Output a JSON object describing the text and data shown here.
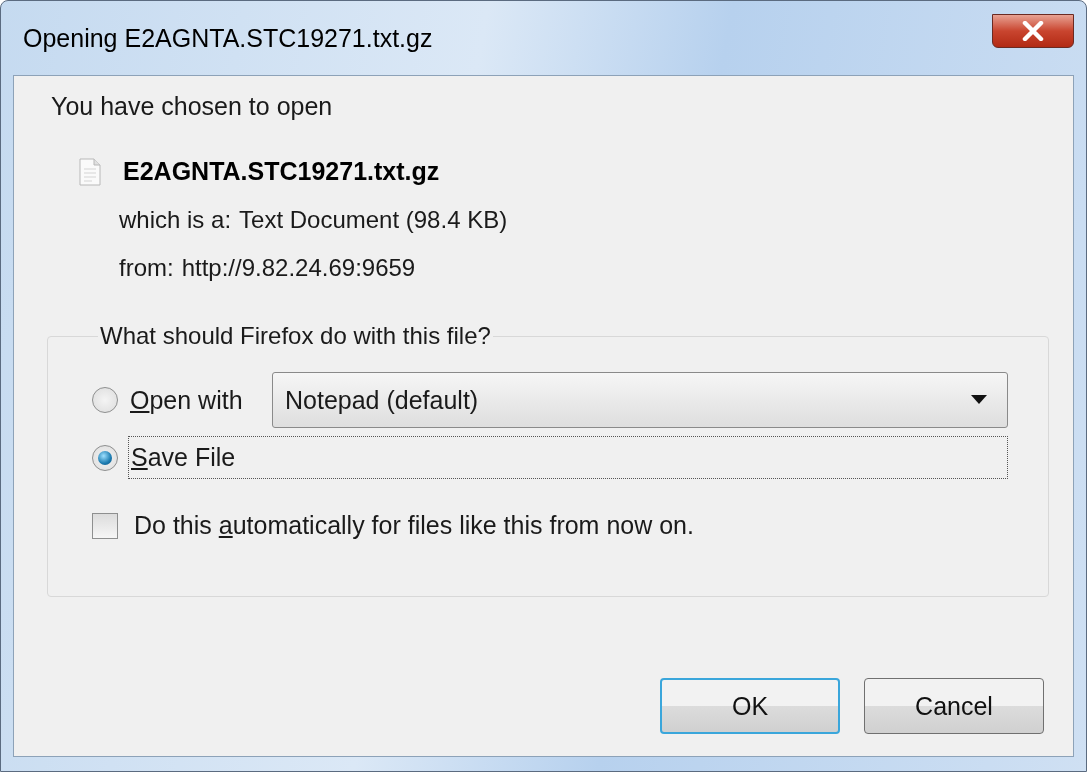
{
  "window": {
    "title": "Opening E2AGNTA.STC19271.txt.gz"
  },
  "intro": "You have chosen to open",
  "file": {
    "name": "E2AGNTA.STC19271.txt.gz",
    "type_label": "which is a:",
    "type": "Text Document (98.4 KB)",
    "source_label": "from:",
    "source": "http://9.82.24.69:9659"
  },
  "action_group": {
    "legend": "What should Firefox do with this file?",
    "options": [
      {
        "kind": "app",
        "key": "O",
        "suffix": "pen with",
        "selected": false,
        "dropdown": "Notepad (default)"
      },
      {
        "kind": "plain",
        "key": "S",
        "suffix": "ave File",
        "selected": true
      }
    ],
    "remember": {
      "prefix": "Do this ",
      "key": "a",
      "suffix": "utomatically for files like this from now on.",
      "checked": false
    }
  },
  "buttons": [
    {
      "label": "OK",
      "default": true
    },
    {
      "label": "Cancel",
      "default": false
    }
  ]
}
